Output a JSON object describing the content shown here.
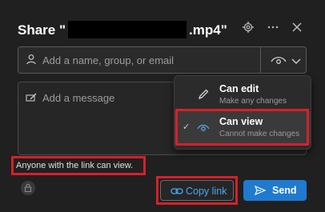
{
  "dialog": {
    "title_prefix": "Share \"",
    "title_suffix": ".mp4\"",
    "people_placeholder": "Add a name, group, or email",
    "message_placeholder": "Add a message",
    "link_info": "Anyone with the link can view.",
    "copy_link_label": "Copy link",
    "send_label": "Send"
  },
  "permission_menu": {
    "items": [
      {
        "title": "Can edit",
        "subtitle": "Make any changes",
        "icon": "pencil-icon",
        "selected": false
      },
      {
        "title": "Can view",
        "subtitle": "Cannot make changes",
        "icon": "eye-icon",
        "selected": true
      }
    ]
  },
  "icons": {
    "settings": "gear-icon",
    "more": "more-icon",
    "close": "close-icon",
    "person": "person-icon",
    "permission": "eye-icon",
    "dropdown": "chevron-down-icon",
    "message": "pen-icon",
    "lock": "lock-icon",
    "link": "link-icon",
    "send": "send-icon"
  },
  "colors": {
    "highlight": "#d6202a",
    "accent": "#1f7ad0",
    "link_text": "#4aa8f0",
    "background": "#202020"
  }
}
